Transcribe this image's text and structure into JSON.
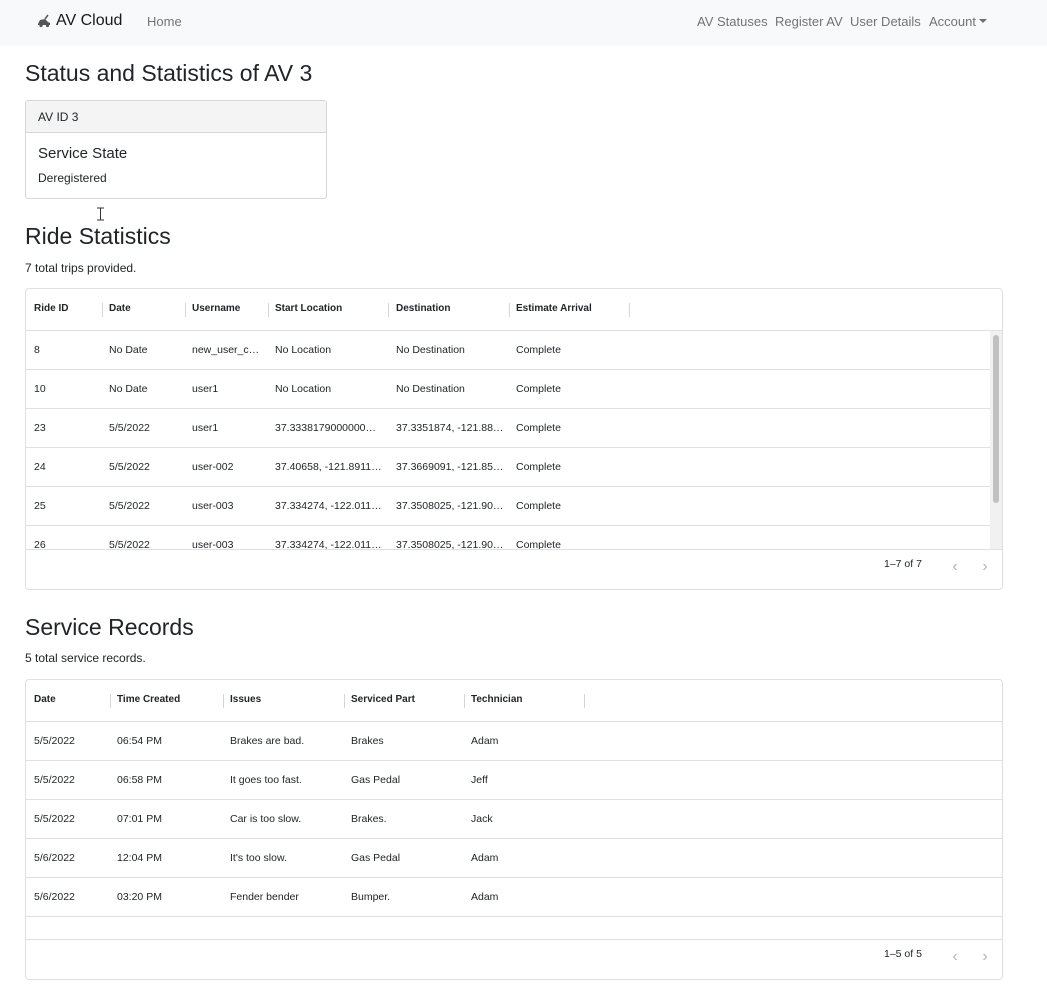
{
  "navbar": {
    "brand": "AV Cloud",
    "brand_icon": "car-icon",
    "home": "Home",
    "av_statuses": "AV Statuses",
    "register_av": "Register AV",
    "user_details": "User Details",
    "account": "Account"
  },
  "page": {
    "title": "Status and Statistics of AV 3"
  },
  "card": {
    "header": "AV ID 3",
    "title": "Service State",
    "value": "Deregistered"
  },
  "rides": {
    "title": "Ride Statistics",
    "summary": "7 total trips provided.",
    "columns": [
      "Ride ID",
      "Date",
      "Username",
      "Start Location",
      "Destination",
      "Estimate Arrival"
    ],
    "rows": [
      [
        "8",
        "No Date",
        "new_user_c…",
        "No Location",
        "No Destination",
        "Complete"
      ],
      [
        "10",
        "No Date",
        "user1",
        "No Location",
        "No Destination",
        "Complete"
      ],
      [
        "23",
        "5/5/2022",
        "user1",
        "37.3338179000000…",
        "37.3351874, -121.88…",
        "Complete"
      ],
      [
        "24",
        "5/5/2022",
        "user-002",
        "37.40658, -121.8911…",
        "37.3669091, -121.85…",
        "Complete"
      ],
      [
        "25",
        "5/5/2022",
        "user-003",
        "37.334274, -122.011…",
        "37.3508025, -121.90…",
        "Complete"
      ],
      [
        "26",
        "5/5/2022",
        "user-003",
        "37.334274, -122.011…",
        "37.3508025, -121.90…",
        "Complete"
      ]
    ],
    "pagination": "1–7 of 7"
  },
  "service": {
    "title": "Service Records",
    "summary": "5 total service records.",
    "columns": [
      "Date",
      "Time Created",
      "Issues",
      "Serviced Part",
      "Technician"
    ],
    "rows": [
      [
        "5/5/2022",
        "06:54 PM",
        "Brakes are bad.",
        "Brakes",
        "Adam"
      ],
      [
        "5/5/2022",
        "06:58 PM",
        "It goes too fast.",
        "Gas Pedal",
        "Jeff"
      ],
      [
        "5/5/2022",
        "07:01 PM",
        "Car is too slow.",
        "Brakes.",
        "Jack"
      ],
      [
        "5/6/2022",
        "12:04 PM",
        "It's too slow.",
        "Gas Pedal",
        "Adam"
      ],
      [
        "5/6/2022",
        "03:20 PM",
        "Fender bender",
        "Bumper.",
        "Adam"
      ]
    ],
    "pagination": "1–5 of 5"
  }
}
